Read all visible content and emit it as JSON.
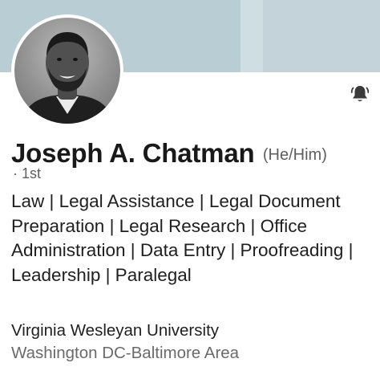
{
  "profile": {
    "name": "Joseph A. Chatman",
    "pronouns": "(He/Him)",
    "degree": "· 1st",
    "headline": "Law | Legal Assistance | Legal Document Preparation | Legal Research | Office Administration | Data Entry | Proofreading | Leadership | Paralegal",
    "school": "Virginia Wesleyan University",
    "location": "Washington DC-Baltimore Area"
  },
  "icons": {
    "notification": "bell-icon",
    "avatar": "profile-photo"
  },
  "colors": {
    "banner": "#b9cdd4",
    "secondary_text": "#5f5f5f",
    "location_text": "#6a6a6a"
  }
}
